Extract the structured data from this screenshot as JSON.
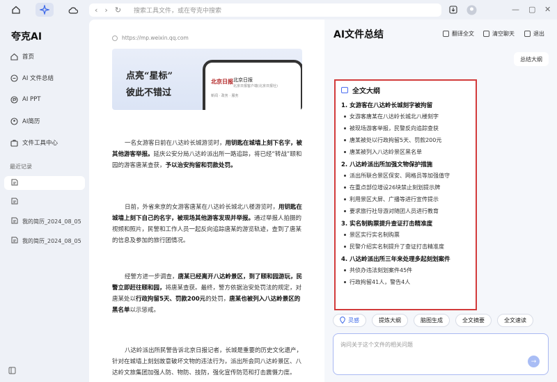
{
  "topbar": {
    "address_placeholder": "搜索工具文件，或在夸克中搜索"
  },
  "sidebar": {
    "brand": "夸克AI",
    "items": [
      {
        "label": "首页",
        "icon": "home-icon"
      },
      {
        "label": "AI 文件总结",
        "icon": "file-summary-icon"
      },
      {
        "label": "AI PPT",
        "icon": "ppt-icon"
      },
      {
        "label": "AI简历",
        "icon": "resume-icon"
      },
      {
        "label": "文件工具中心",
        "icon": "toolbox-icon"
      }
    ],
    "recent_title": "最近记录",
    "recent": [
      {
        "label": ""
      },
      {
        "label": ""
      },
      {
        "label": "我的简历_2024_08_05"
      },
      {
        "label": "我的简历_2024_08_05"
      }
    ]
  },
  "doc": {
    "url": "https://mp.weixin.qq.com",
    "banner_line1": "点亮“星标”",
    "banner_line2": "彼此不错过",
    "phone_logo": "北京日报",
    "phone_name": "北京日报",
    "phone_sub": "北京日报客户端(北京日报社)",
    "phone_meta": "新闻 · 政务 · 服务",
    "p1_a": "一名女游客日前在八达岭长城游览时，",
    "p1_b": "用钥匙在城墙上刻下名字，被其他游客举报。",
    "p1_c": "延庆公安分局八达岭派出所一路追踪，将已经“转战”颐和园的游客唐某查获，",
    "p1_d": "予以治安拘留和罚款处罚。",
    "p2_a": "日前，外省来京的女游客唐某在八达岭长城北八楼游览时，",
    "p2_b": "用钥匙在城墙上刻下自己的名字，被现场其他游客发现并举报。",
    "p2_c": "通过举报人拍摄的视频和照片，民警和工作人员一起反向追踪唐某的游览轨迹，查到了唐某的信息及参加的旅行团情况。",
    "p3_a": "经警方进一步调查，",
    "p3_b": "唐某已经离开八达岭景区，到了颐和园游玩，民警立即赶往颐和园，",
    "p3_c": "将唐某查获。最终，警方依据治安处罚法的规定，对唐某处以",
    "p3_d": "行政拘留5天、罚款200元",
    "p3_e": "的处罚，",
    "p3_f": "唐某也被列入八达岭景区的黑名单",
    "p3_g": "以示惩戒。",
    "p4": "八达岭派出所民警告诉北京日报记者，长城是重要的历史文化遗产，针对在城墙上刻划故意破坏文物的违法行为，派出所会同八达岭景区、八达岭文旅集团加强人防、物防、技防，强化宣传防范和打击震慑力度。"
  },
  "right": {
    "title": "AI文件总结",
    "actions": [
      "翻译全文",
      "清空聊天",
      "退出"
    ],
    "summary_button": "总结大纲",
    "outline_title": "全文大纲",
    "sections": [
      {
        "title": "1. 女游客在八达岭长城刻字被拘留",
        "bullets": [
          "女游客唐某在八达岭长城北八楼刻字",
          "被现场游客举报，民警反向追踪查获",
          "唐某被处以行政拘留5天、罚款200元",
          "唐某被列入八达岭景区黑名单"
        ]
      },
      {
        "title": "2. 八达岭派出所加强文物保护措施",
        "bullets": [
          "派出所联合景区保安、网格员等加强值守",
          "在重点部位增设26块禁止刻划提示牌",
          "利用景区大屏、广播等进行宣传提示",
          "要求旅行社导游对随团人员进行教育"
        ]
      },
      {
        "title": "3. 实名制购票提升查证打击精准度",
        "bullets": [
          "景区实行实名制购票",
          "民警介绍实名制提升了查证打击精准度"
        ]
      },
      {
        "title": "4. 八达岭派出所三年来处理多起刻划案件",
        "bullets": [
          "共侦办违法刻划案件45件",
          "行政拘留41人，警告4人"
        ]
      }
    ],
    "chips": [
      "灵感",
      "提炼大纲",
      "脑图生成",
      "全文摘要",
      "全文速读"
    ],
    "ask_placeholder": "询问关于这个文件的相关问题"
  }
}
